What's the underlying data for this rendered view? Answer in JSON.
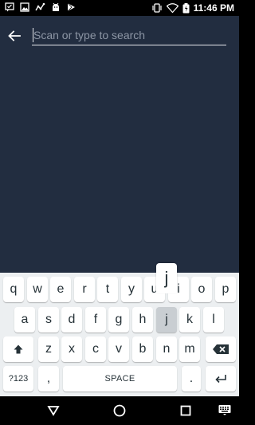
{
  "status_bar": {
    "time": "11:46 PM",
    "left_icons": [
      "message-icon",
      "image-icon",
      "activity-icon",
      "android-icon",
      "play-store-icon"
    ],
    "right_icons": [
      "vibrate-icon",
      "wifi-icon",
      "battery-icon"
    ]
  },
  "search": {
    "placeholder": "Scan or type to search",
    "value": ""
  },
  "keyboard": {
    "popup_letter": "j",
    "row1": [
      "q",
      "w",
      "e",
      "r",
      "t",
      "y",
      "u",
      "i",
      "o",
      "p"
    ],
    "row2": [
      "a",
      "s",
      "d",
      "f",
      "g",
      "h",
      "j",
      "k",
      "l"
    ],
    "row3_letters": [
      "z",
      "x",
      "c",
      "v",
      "b",
      "n",
      "m"
    ],
    "symbols_label": "?123",
    "comma": ",",
    "space_label": "SPACE",
    "period": "."
  },
  "colors": {
    "app_bg": "#222d40",
    "keyboard_bg": "#eceff1",
    "key_bg": "#ffffff",
    "pressed_key": "#c9ced2"
  }
}
